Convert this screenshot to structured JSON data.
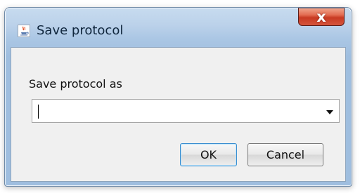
{
  "window": {
    "title": "Save protocol",
    "close_symbol": "x"
  },
  "dialog": {
    "prompt": "Save protocol as",
    "input": {
      "value": "",
      "placeholder": ""
    },
    "buttons": {
      "ok": "OK",
      "cancel": "Cancel"
    }
  },
  "icons": {
    "app_icon": "java-cup-icon",
    "dropdown_icon": "chevron-down-icon",
    "close_icon": "close-icon"
  },
  "colors": {
    "titlebar": "#bcd2ea",
    "close_button": "#c83a22",
    "client_background": "#f0f0f0",
    "default_button_border": "#3a8ed0"
  }
}
